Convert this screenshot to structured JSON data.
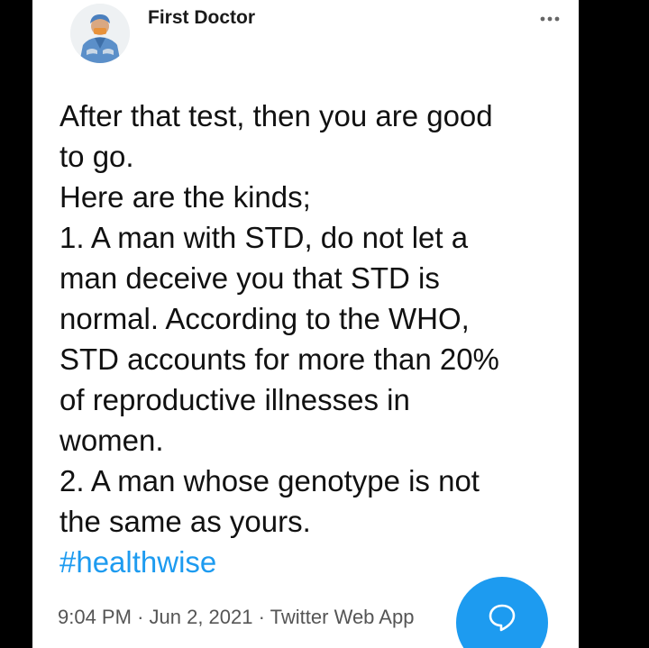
{
  "tweet": {
    "author_name": "First Doctor",
    "avatar_icon": "doctor-avatar",
    "more_icon": "more-options-icon",
    "body_lines": [
      "After that test, then you are good",
      "to go.",
      "Here are the kinds;",
      "1. A man with STD, do not let a",
      "man deceive you that STD is",
      "normal. According to the WHO,",
      "STD accounts for more than 20%",
      "of reproductive illnesses in",
      "women.",
      "2. A man whose genotype is not",
      "the same as yours."
    ],
    "hashtag": "#healthwise",
    "time": "9:04 PM",
    "separator": "·",
    "date": "Jun 2, 2021",
    "source": "Twitter Web App"
  },
  "fab": {
    "icon": "reply-bubble-icon"
  },
  "colors": {
    "accent": "#1d9bf0",
    "background": "#000000",
    "card": "#ffffff"
  }
}
